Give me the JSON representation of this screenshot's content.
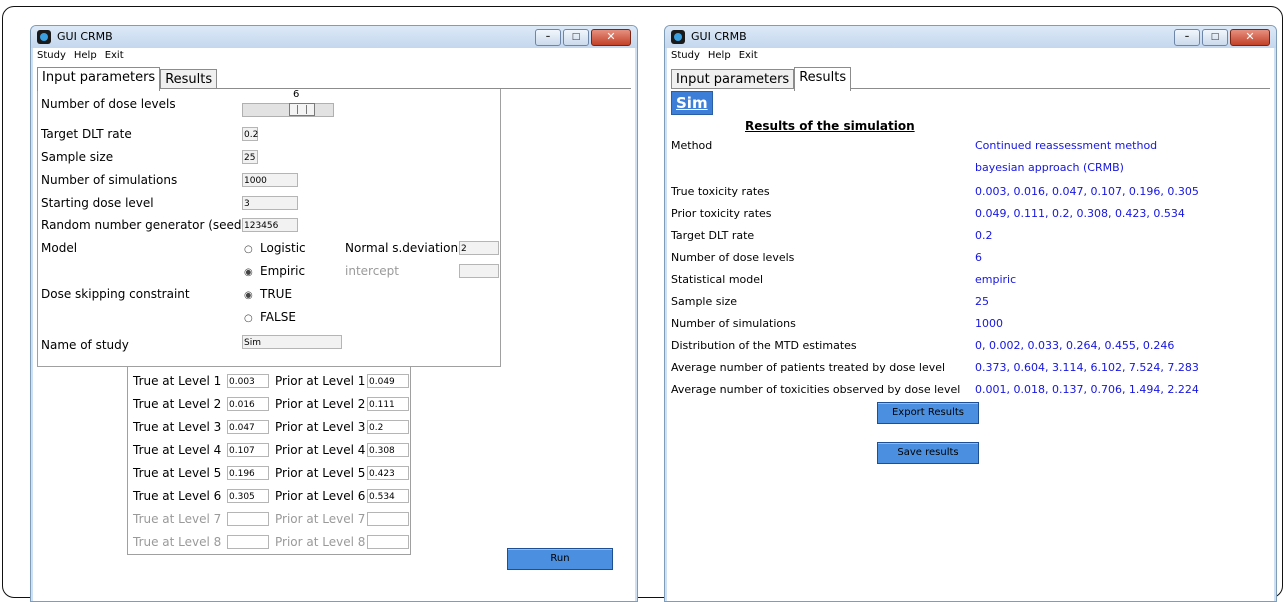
{
  "left_window": {
    "title": "GUI CRMB",
    "menu": [
      "Study",
      "Help",
      "Exit"
    ],
    "tabs": [
      "Input parameters",
      "Results"
    ],
    "params": {
      "num_dose_levels_label": "Number of dose levels",
      "num_dose_levels_value": "6",
      "num_dose_levels_slider_fraction": 0.714,
      "target_dlt_label": "Target DLT rate",
      "target_dlt_value": "0.2",
      "sample_size_label": "Sample size",
      "sample_size_value": "25",
      "num_sims_label": "Number of simulations",
      "num_sims_value": "1000",
      "start_dose_label": "Starting dose level",
      "start_dose_value": "3",
      "seed_label": "Random number generator (seed)",
      "seed_value": "123456",
      "model_label": "Model",
      "logistic_label": "Logistic",
      "empiric_label": "Empiric",
      "normal_sd_label": "Normal s.deviation",
      "normal_sd_value": "2",
      "intercept_label": "intercept",
      "intercept_value": "",
      "dose_skip_label": "Dose skipping constraint",
      "true_label": "TRUE",
      "false_label": "FALSE",
      "study_name_label": "Name of study",
      "study_name_value": "Sim"
    },
    "levels": [
      {
        "true_label": "True at Level 1",
        "true_value": "0.003",
        "prior_label": "Prior at Level 1",
        "prior_value": "0.049"
      },
      {
        "true_label": "True at Level 2",
        "true_value": "0.016",
        "prior_label": "Prior at Level 2",
        "prior_value": "0.111"
      },
      {
        "true_label": "True at Level 3",
        "true_value": "0.047",
        "prior_label": "Prior at Level 3",
        "prior_value": "0.2"
      },
      {
        "true_label": "True at Level 4",
        "true_value": "0.107",
        "prior_label": "Prior at Level 4",
        "prior_value": "0.308"
      },
      {
        "true_label": "True at Level 5",
        "true_value": "0.196",
        "prior_label": "Prior at Level 5",
        "prior_value": "0.423"
      },
      {
        "true_label": "True at Level 6",
        "true_value": "0.305",
        "prior_label": "Prior at Level 6",
        "prior_value": "0.534"
      },
      {
        "true_label": "True at Level 7",
        "true_value": "",
        "prior_label": "Prior at Level 7",
        "prior_value": ""
      },
      {
        "true_label": "True at Level 8",
        "true_value": "",
        "prior_label": "Prior at Level 8",
        "prior_value": ""
      }
    ],
    "run_label": "Run"
  },
  "right_window": {
    "title": "GUI CRMB",
    "menu": [
      "Study",
      "Help",
      "Exit"
    ],
    "tabs": [
      "Input parameters",
      "Results"
    ],
    "study_badge": "Sim",
    "heading": "Results of the simulation",
    "rows": [
      {
        "label": "Method",
        "value": "Continued reassessment method"
      },
      {
        "label": "",
        "value": "bayesian approach (CRMB)"
      },
      {
        "label": "True toxicity rates",
        "value": "0.003, 0.016, 0.047, 0.107, 0.196, 0.305"
      },
      {
        "label": "Prior toxicity rates",
        "value": "0.049, 0.111, 0.2, 0.308, 0.423, 0.534"
      },
      {
        "label": "Target DLT rate",
        "value": "0.2"
      },
      {
        "label": "Number of dose levels",
        "value": "6"
      },
      {
        "label": "Statistical model",
        "value": "empiric"
      },
      {
        "label": "Sample size",
        "value": "25"
      },
      {
        "label": "Number of simulations",
        "value": "1000"
      },
      {
        "label": "Distribution of the MTD estimates",
        "value": "0, 0.002, 0.033, 0.264, 0.455, 0.246"
      },
      {
        "label": "Average number of patients treated by dose level",
        "value": "0.373, 0.604, 3.114, 6.102, 7.524, 7.283"
      },
      {
        "label": "Average number of toxicities observed by dose level",
        "value": "0.001, 0.018, 0.137, 0.706, 1.494, 2.224"
      }
    ],
    "export_label": "Export Results",
    "save_label": "Save results"
  },
  "colors": {
    "value_blue": "#1616e0",
    "button_blue": "#4a8fe0",
    "badge_bg": "#3d7fd8"
  }
}
